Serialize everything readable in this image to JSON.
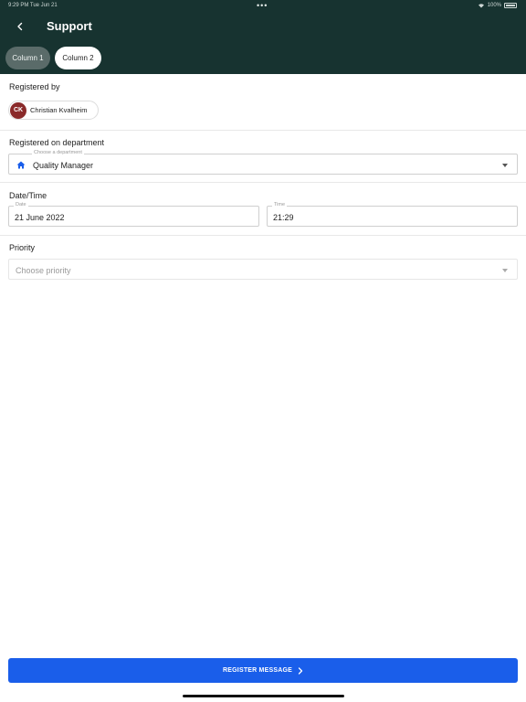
{
  "status_bar": {
    "time": "9:29 PM  Tue Jun 21",
    "battery": "100%"
  },
  "header": {
    "title": "Support"
  },
  "tabs": [
    {
      "label": "Column 1"
    },
    {
      "label": "Column 2"
    }
  ],
  "registered_by": {
    "label": "Registered by",
    "initials": "CK",
    "name": "Christian Kvalheim"
  },
  "department": {
    "label": "Registered on department",
    "caption": "Choose a department",
    "value": "Quality Manager"
  },
  "datetime": {
    "label": "Date/Time",
    "date_caption": "Date",
    "date_value": "21 June 2022",
    "time_caption": "Time",
    "time_value": "21:29"
  },
  "priority": {
    "label": "Priority",
    "placeholder": "Choose priority"
  },
  "footer": {
    "button_label": "REGISTER MESSAGE"
  },
  "colors": {
    "header_bg": "#173330",
    "primary": "#1a5eea",
    "avatar_bg": "#8a2a2a"
  }
}
